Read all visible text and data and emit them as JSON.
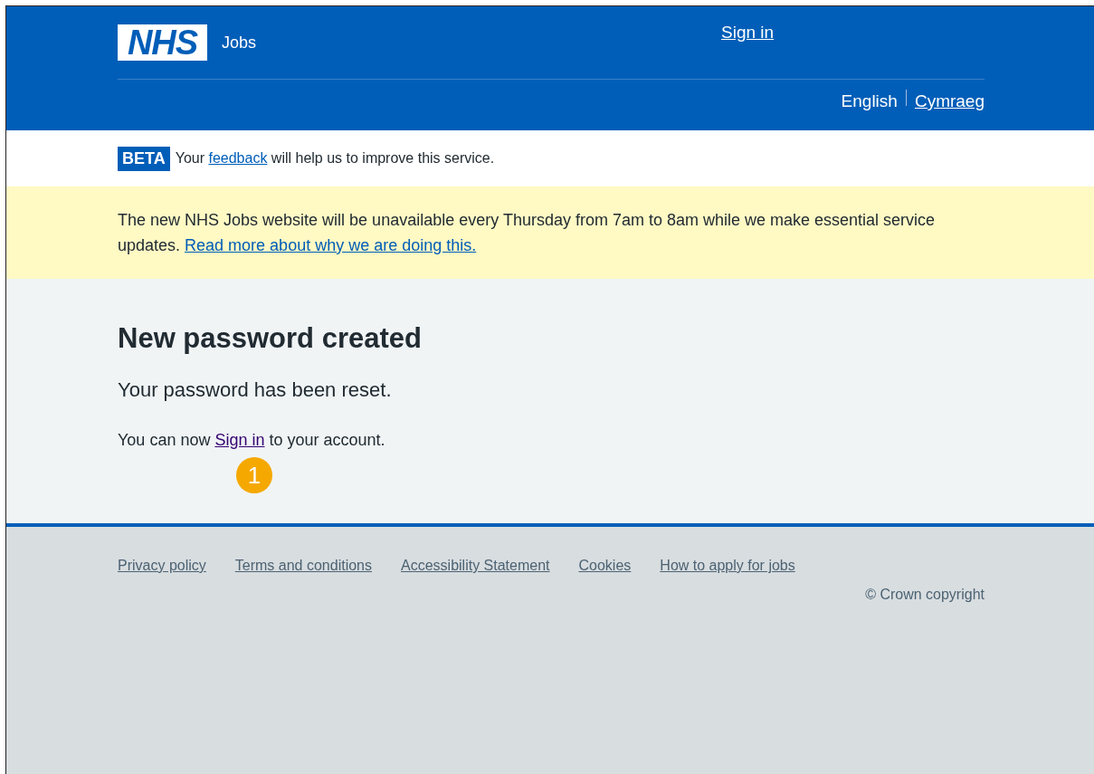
{
  "header": {
    "logo": "NHS",
    "service": "Jobs",
    "sign_in": "Sign in",
    "languages": [
      {
        "label": "English",
        "selected": true
      },
      {
        "label": "Cymraeg",
        "selected": false
      }
    ]
  },
  "beta": {
    "tag": "BETA",
    "before": "Your ",
    "link": "feedback",
    "after": " will help us to improve this service."
  },
  "notice": {
    "text": "The new NHS Jobs website will be unavailable every Thursday from 7am to 8am while we make essential service updates. ",
    "link": "Read more about why we are doing this."
  },
  "main": {
    "heading": "New password created",
    "lead": "Your password has been reset.",
    "before": "You can now ",
    "link": "Sign in",
    "after": " to your account.",
    "marker": "1"
  },
  "footer": {
    "links": [
      "Privacy policy",
      "Terms and conditions",
      "Accessibility Statement",
      "Cookies",
      "How to apply for jobs"
    ],
    "copyright": "© Crown copyright"
  }
}
